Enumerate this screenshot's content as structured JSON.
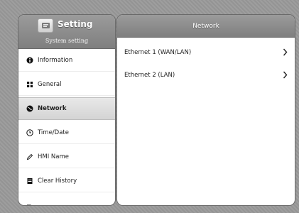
{
  "sidebar": {
    "title": "Setting",
    "subtitle": "System setting",
    "items": [
      {
        "label": "Information",
        "icon": "info-icon"
      },
      {
        "label": "General",
        "icon": "grid-icon"
      },
      {
        "label": "Network",
        "icon": "globe-icon",
        "selected": true
      },
      {
        "label": "Time/Date",
        "icon": "clock-icon"
      },
      {
        "label": "HMI Name",
        "icon": "pen-icon"
      },
      {
        "label": "Clear History",
        "icon": "trash-icon"
      },
      {
        "label": "",
        "icon": "partial-icon"
      }
    ]
  },
  "main": {
    "title": "Network",
    "rows": [
      {
        "label": "Ethernet 1 (WAN/LAN)"
      },
      {
        "label": "Ethernet 2 (LAN)"
      }
    ]
  },
  "colors": {
    "header": "#8a8a8a",
    "selected_row": "#dcdcdc",
    "panel": "#ffffff"
  }
}
